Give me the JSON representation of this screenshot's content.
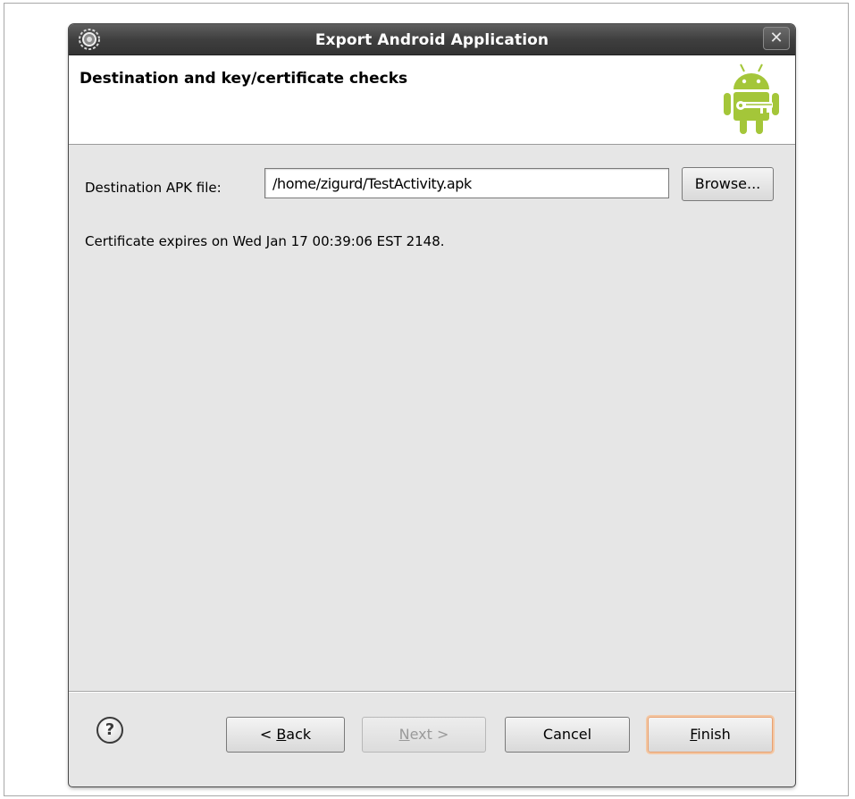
{
  "window": {
    "title": "Export Android Application",
    "close_glyph": "✕"
  },
  "header": {
    "title": "Destination and key/certificate checks",
    "logo_icon": "android-key-icon"
  },
  "destination": {
    "label": "Destination APK file:",
    "value": "/home/zigurd/TestActivity.apk",
    "browse_label": "Browse..."
  },
  "certificate": {
    "message": "Certificate expires on Wed Jan 17 00:39:06 EST 2148."
  },
  "footer": {
    "help_glyph": "?",
    "back": {
      "prefix": "< ",
      "mnemonic": "B",
      "rest": "ack"
    },
    "next": {
      "mnemonic": "N",
      "rest": "ext >"
    },
    "cancel_label": "Cancel",
    "finish": {
      "mnemonic": "F",
      "rest": "inish"
    }
  },
  "colors": {
    "android_green": "#A4C639",
    "titlebar_dark": "#3F3F3F",
    "finish_focus": "#E8A070"
  }
}
